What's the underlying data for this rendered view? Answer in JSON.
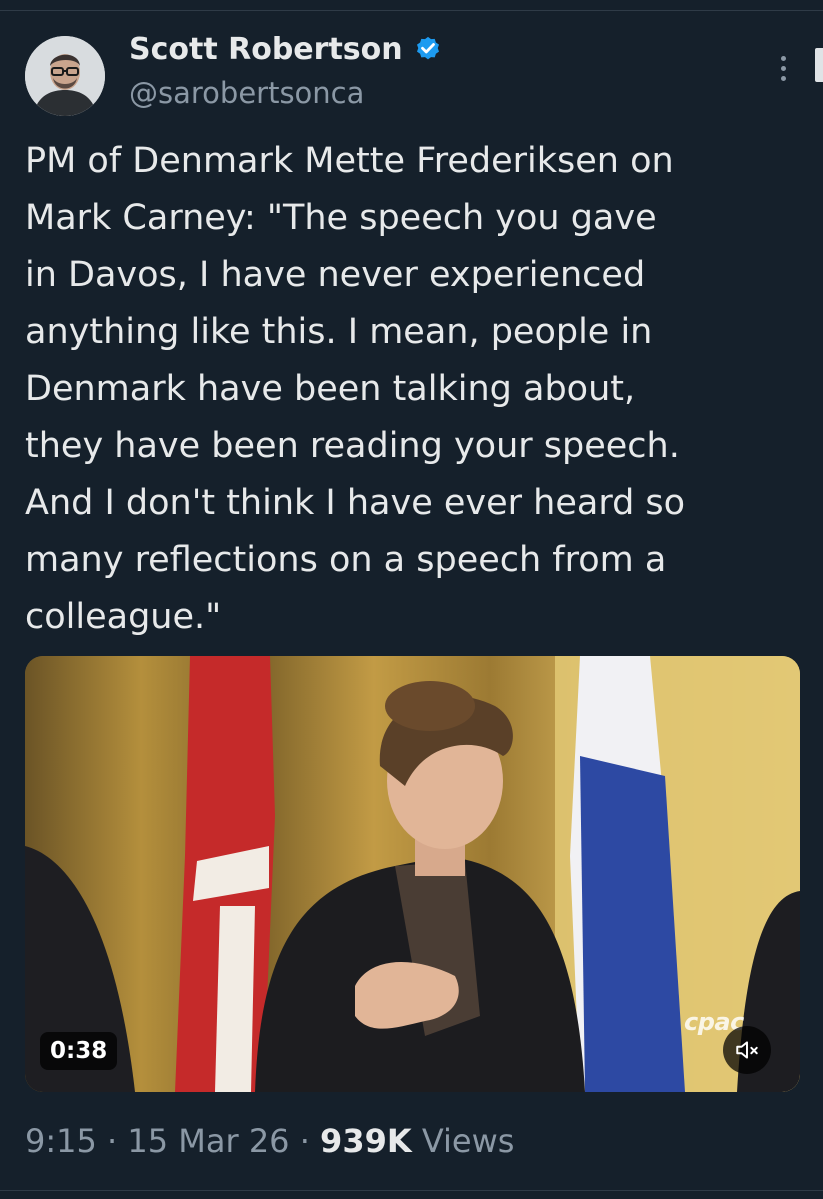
{
  "author": {
    "display_name": "Scott Robertson",
    "handle": "@sarobertsonca",
    "verified": true,
    "verified_color": "#1d9bf0"
  },
  "tweet": {
    "text": "PM of Denmark Mette Frederiksen on\nMark Carney: \"The speech you gave\nin Davos, I have never experienced\nanything like this. I mean, people in\nDenmark have been talking about,\nthey have been reading your speech.\nAnd I don't think I have ever heard so\nmany reflections on a speech from a\ncolleague.\""
  },
  "video": {
    "duration": "0:38",
    "watermark": "cpac",
    "muted": true
  },
  "meta": {
    "time": "9:15",
    "separator": "·",
    "date": "15 Mar 26",
    "views_count": "939K",
    "views_label": "Views"
  },
  "icons": {
    "more": "more-vertical-icon",
    "verified": "verified-badge-icon",
    "mute": "speaker-muted-icon"
  }
}
